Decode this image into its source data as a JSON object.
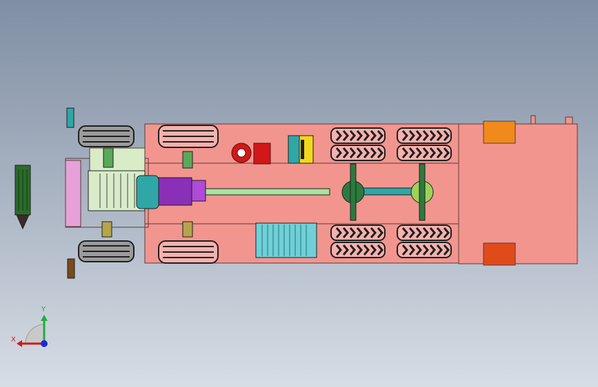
{
  "viewport": {
    "background_top": "#7f8ea3",
    "background_bottom": "#d7dde5"
  },
  "model": {
    "name": "truck-chassis-top-view",
    "colors": {
      "frame_pink": "#f2958f",
      "frame_outline": "#5a3a3a",
      "tire_dark": "#1f1f1f",
      "engine_teal": "#2fa7a7",
      "engine_purple": "#8a2fb8",
      "axle_green": "#2c7a3e",
      "driveshaft_green": "#a8e3a0",
      "battery_teal": "#6fd0d8",
      "light_orange": "#f08a1c",
      "light_red": "#e04b1a",
      "tank_red": "#d01818",
      "tank_yellow": "#f1d81c",
      "spring_green": "#5aa85a"
    }
  },
  "triad": {
    "x_label": "X",
    "y_label": "Y",
    "x_color": "#d01a1a",
    "y_color": "#1fae3a",
    "z_color": "#1a2ad8"
  }
}
